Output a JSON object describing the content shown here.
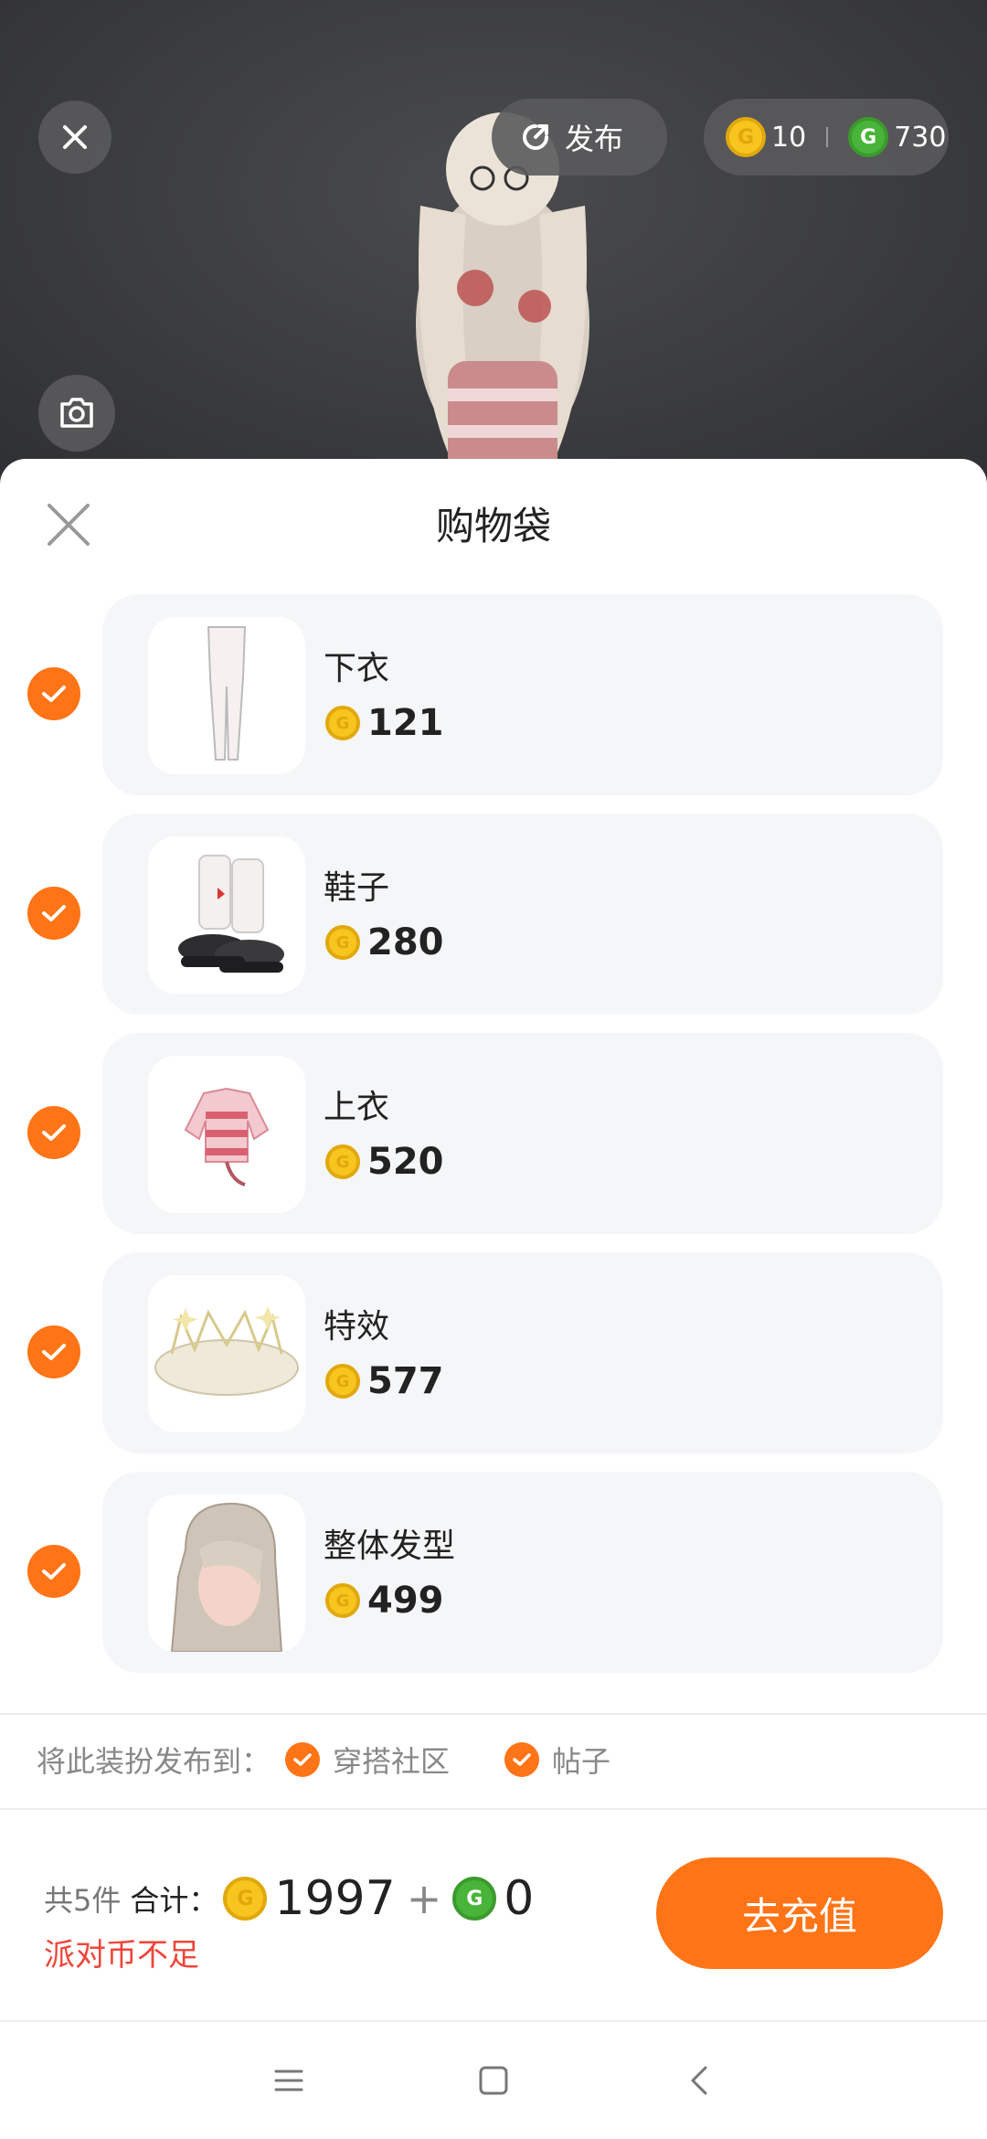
{
  "topbar": {
    "publish_label": "发布",
    "gold_balance": "10",
    "green_balance": "730",
    "gold_coin_symbol": "G",
    "green_coin_symbol": "G"
  },
  "sheet": {
    "title": "购物袋",
    "items": [
      {
        "name": "下衣",
        "price": "121",
        "checked": true,
        "icon": "leggings"
      },
      {
        "name": "鞋子",
        "price": "280",
        "checked": true,
        "icon": "boots"
      },
      {
        "name": "上衣",
        "price": "520",
        "checked": true,
        "icon": "sweater"
      },
      {
        "name": "特效",
        "price": "577",
        "checked": true,
        "icon": "sparkle-crown"
      },
      {
        "name": "整体发型",
        "price": "499",
        "checked": true,
        "icon": "long-hair"
      }
    ],
    "publish": {
      "label": "将此装扮发布到：",
      "options": [
        {
          "label": "穿搭社区",
          "checked": true
        },
        {
          "label": "帖子",
          "checked": true
        }
      ]
    },
    "footer": {
      "count_text": "共5件",
      "total_label": "合计：",
      "gold_total": "1997",
      "plus": "+",
      "green_total": "0",
      "warning": "派对币不足",
      "recharge_label": "去充值"
    }
  },
  "colors": {
    "accent": "#ff7416",
    "warning": "#f0453a",
    "gold_coin": "#f7c51d",
    "green_coin": "#49b43a",
    "card_bg": "#f5f6f8"
  }
}
